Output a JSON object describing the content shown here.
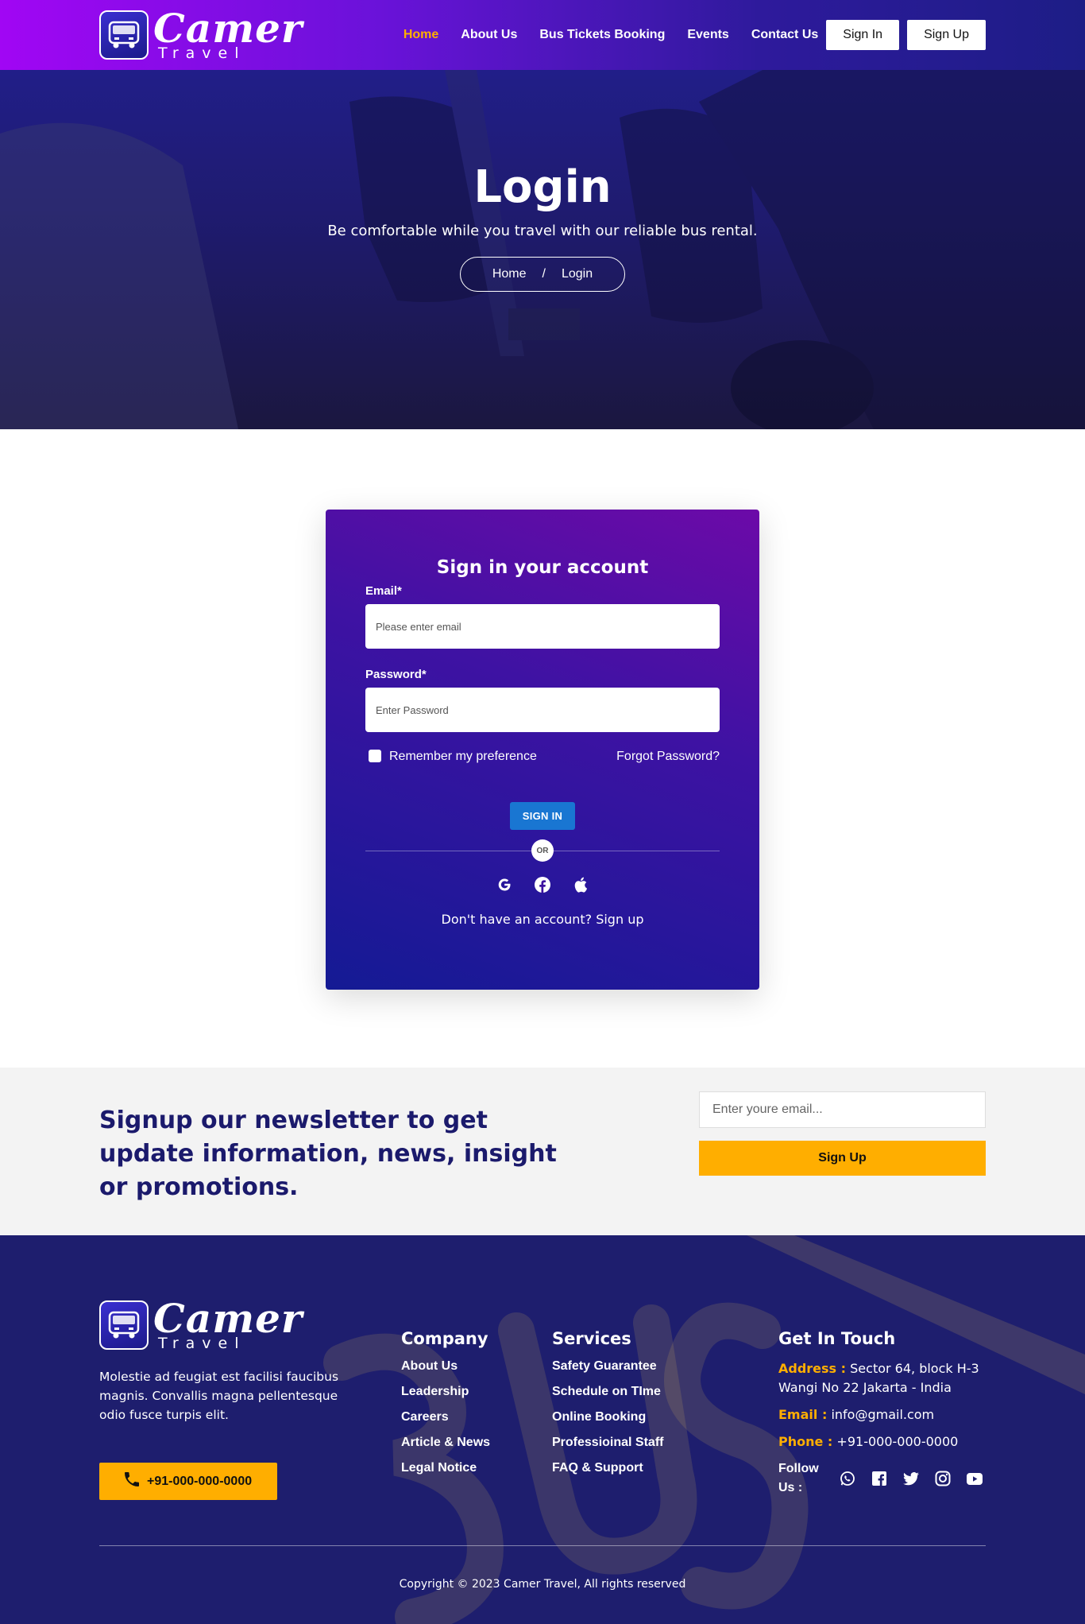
{
  "brand": {
    "name": "Camer",
    "sub": "Travel"
  },
  "nav": {
    "items": [
      {
        "label": "Home",
        "active": true
      },
      {
        "label": "About Us"
      },
      {
        "label": "Bus Tickets Booking"
      },
      {
        "label": "Events"
      },
      {
        "label": "Contact Us"
      }
    ],
    "sign_in": "Sign In",
    "sign_up": "Sign Up"
  },
  "hero": {
    "title": "Login",
    "subtitle": "Be comfortable while you travel with our reliable bus rental.",
    "breadcrumb": {
      "home": "Home",
      "separator": "/",
      "current": "Login"
    }
  },
  "login": {
    "title": "Sign in your account",
    "email_label": "Email*",
    "email_placeholder": "Please enter email",
    "password_label": "Password*",
    "password_placeholder": "Enter Password",
    "remember_label": "Remember my preference",
    "forgot_label": "Forgot Password?",
    "submit_label": "SIGN IN",
    "or_label": "OR",
    "social_icons": [
      "google-icon",
      "facebook-icon",
      "apple-icon"
    ],
    "signup_text": "Don't have an account? Sign up"
  },
  "newsletter": {
    "heading": "Signup our newsletter to get update information, news, insight or promotions.",
    "placeholder": "Enter youre email...",
    "button": "Sign Up"
  },
  "footer": {
    "description": "Molestie ad feugiat est facilisi faucibus magnis. Convallis magna pellentesque odio fusce turpis elit.",
    "phone_button": "+91-000-000-0000",
    "company": {
      "title": "Company",
      "links": [
        "About Us",
        "Leadership",
        "Careers",
        "Article & News",
        "Legal Notice"
      ]
    },
    "services": {
      "title": "Services",
      "links": [
        "Safety Guarantee",
        "Schedule on TIme",
        "Online Booking",
        "Professioinal Staff",
        "FAQ & Support"
      ]
    },
    "contact": {
      "title": "Get In Touch",
      "address_label": "Address :",
      "address": "Sector 64, block H-3 Wangi No 22 Jakarta - India",
      "email_label": "Email :",
      "email": "info@gmail.com",
      "phone_label": "Phone :",
      "phone": "+91-000-000-0000",
      "follow_label": "Follow Us :",
      "social_icons": [
        "whatsapp-icon",
        "facebook-icon",
        "twitter-icon",
        "instagram-icon",
        "youtube-icon"
      ]
    },
    "copyright": "Copyright © 2023 Camer Travel, All rights reserved"
  },
  "colors": {
    "accent": "#ffae00",
    "header_start": "#a106f4",
    "header_end": "#1d1d86",
    "card_top": "#6c0aa8",
    "card_bottom": "#141a94",
    "footer_bg": "#1e1e6e",
    "heading_navy": "#1b1a6c",
    "signin_blue": "#1976d2"
  }
}
